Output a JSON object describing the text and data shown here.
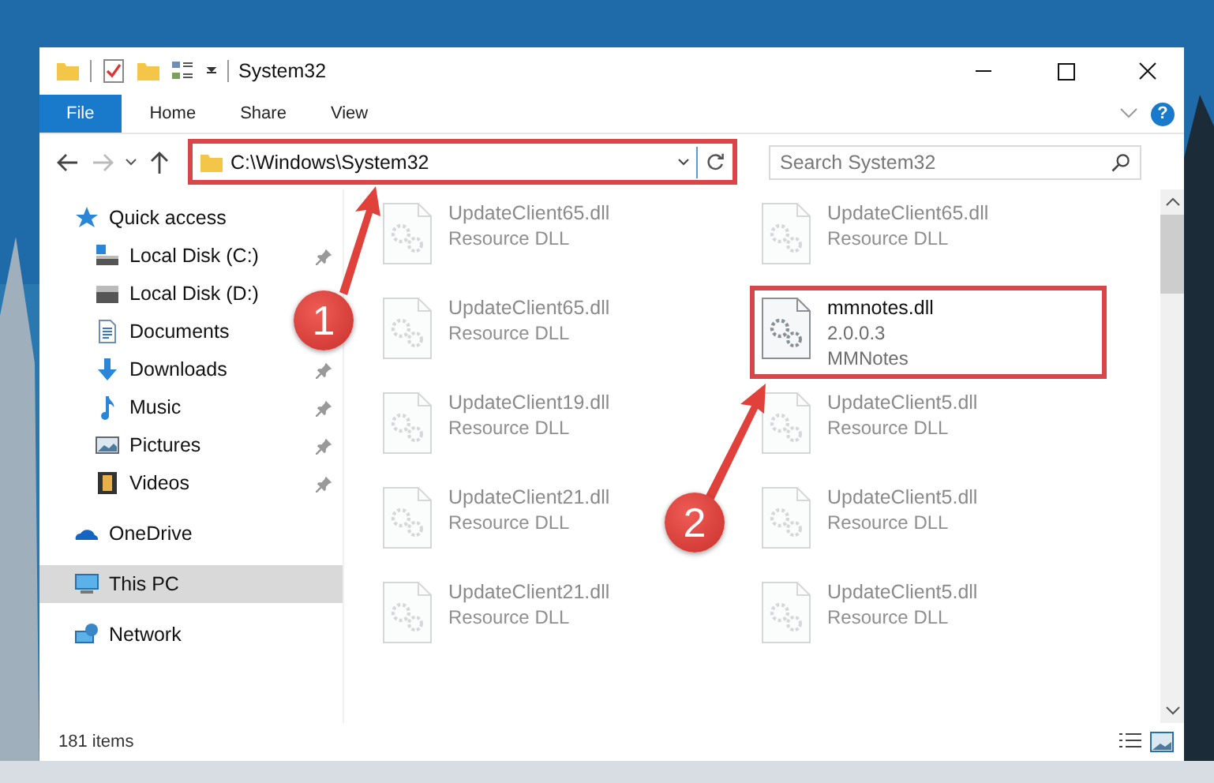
{
  "window": {
    "title": "System32"
  },
  "ribbon": {
    "tabs": [
      {
        "label": "File",
        "kind": "file"
      },
      {
        "label": "Home",
        "kind": "tab"
      },
      {
        "label": "Share",
        "kind": "tab"
      },
      {
        "label": "View",
        "kind": "tab"
      }
    ],
    "help": "?"
  },
  "address_bar": {
    "path": "C:\\Windows\\System32",
    "highlighted": true
  },
  "search": {
    "placeholder": "Search System32"
  },
  "sidebar": {
    "items": [
      {
        "label": "Quick access",
        "kind": "star",
        "selected": false,
        "children": [
          {
            "label": "Local Disk (C:)",
            "kind": "system-drive",
            "pinned": true
          },
          {
            "label": "Local Disk (D:)",
            "kind": "drive",
            "pinned": false
          },
          {
            "label": "Documents",
            "kind": "documents",
            "pinned": false
          },
          {
            "label": "Downloads",
            "kind": "downloads",
            "pinned": true
          },
          {
            "label": "Music",
            "kind": "music",
            "pinned": true
          },
          {
            "label": "Pictures",
            "kind": "pictures",
            "pinned": true
          },
          {
            "label": "Videos",
            "kind": "videos",
            "pinned": true
          }
        ]
      },
      {
        "label": "OneDrive",
        "kind": "cloud",
        "selected": false
      },
      {
        "label": "This PC",
        "kind": "computer",
        "selected": true
      },
      {
        "label": "Network",
        "kind": "network",
        "selected": false
      }
    ]
  },
  "files": [
    {
      "name": "UpdateClient65.dll",
      "lines": [
        "Resource DLL"
      ],
      "faded": true,
      "highlighted": false
    },
    {
      "name": "UpdateClient65.dll",
      "lines": [
        "Resource DLL"
      ],
      "faded": true,
      "highlighted": false
    },
    {
      "name": "UpdateClient65.dll",
      "lines": [
        "Resource DLL"
      ],
      "faded": true,
      "highlighted": false
    },
    {
      "name": "mmnotes.dll",
      "lines": [
        "2.0.0.3",
        "MMNotes"
      ],
      "faded": false,
      "highlighted": true
    },
    {
      "name": "UpdateClient19.dll",
      "lines": [
        "Resource DLL"
      ],
      "faded": true,
      "highlighted": false
    },
    {
      "name": "UpdateClient5.dll",
      "lines": [
        "Resource DLL"
      ],
      "faded": true,
      "highlighted": false
    },
    {
      "name": "UpdateClient21.dll",
      "lines": [
        "Resource DLL"
      ],
      "faded": true,
      "highlighted": false
    },
    {
      "name": "UpdateClient5.dll",
      "lines": [
        "Resource DLL"
      ],
      "faded": true,
      "highlighted": false
    },
    {
      "name": "UpdateClient21.dll",
      "lines": [
        "Resource DLL"
      ],
      "faded": true,
      "highlighted": false
    },
    {
      "name": "UpdateClient5.dll",
      "lines": [
        "Resource DLL"
      ],
      "faded": true,
      "highlighted": false
    }
  ],
  "status_bar": {
    "item_count": "181 items"
  },
  "callouts": [
    {
      "number": "1"
    },
    {
      "number": "2"
    }
  ]
}
